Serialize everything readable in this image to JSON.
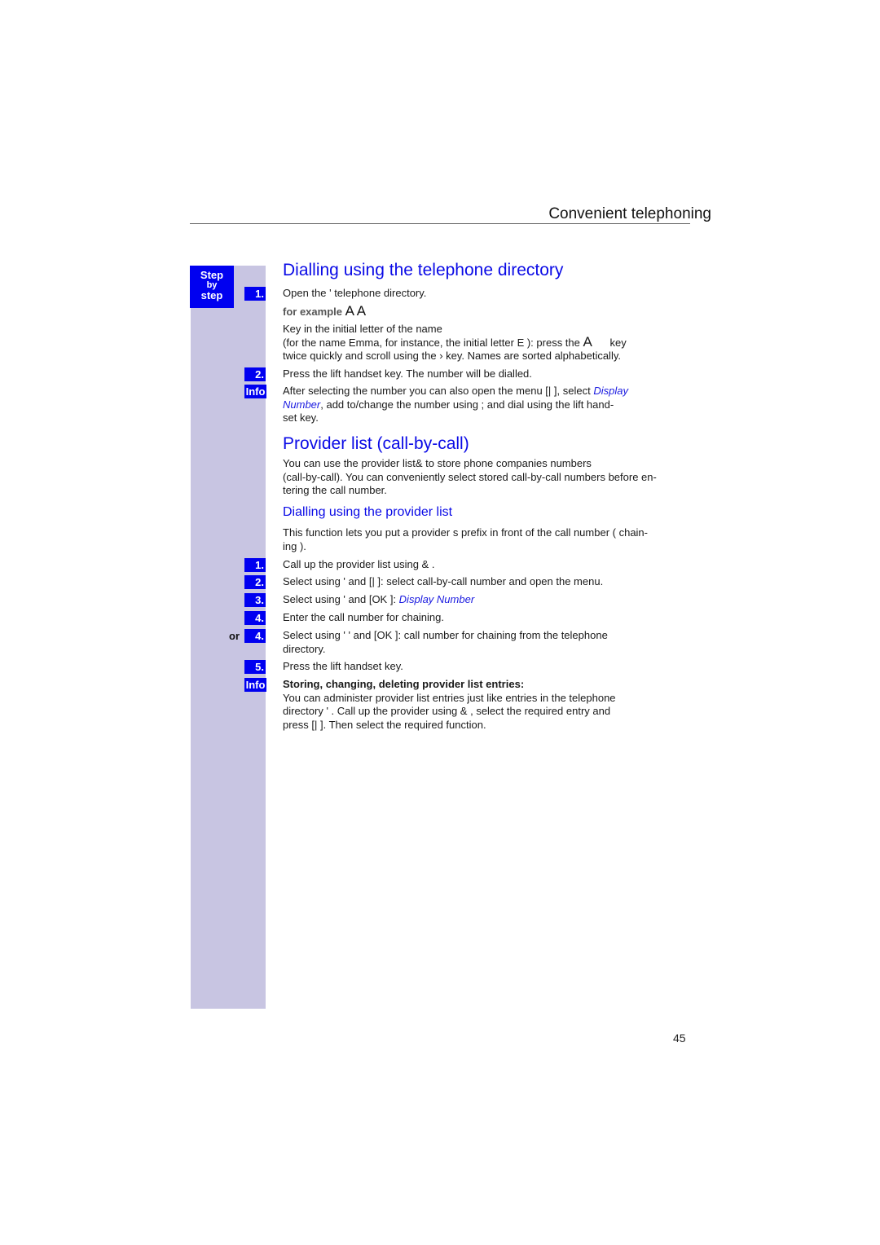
{
  "header": {
    "title": "Convenient telephoning"
  },
  "sidebar": {
    "step_label": [
      "Step",
      "by",
      "step"
    ]
  },
  "section1": {
    "title": "Dialling using the telephone directory",
    "steps": [
      {
        "badge": "1.",
        "text": "Open the '     telephone directory."
      },
      {
        "badge": "2.",
        "text": "Press the        lift handset key. The number will be dialled."
      }
    ],
    "example_label": "for example",
    "example_keys": "A A",
    "key_in_lines": [
      "Key in the initial letter of the name",
      "(for the name   Emma,  for instance, the initial letter   E  ): press the",
      "key",
      "twice quickly and scroll using the ›      key. Names are sorted alphabetically."
    ],
    "key_glyph": "A",
    "info_badge": "Info",
    "info_text_1": "After selecting the number you can also open the menu [|     ], select ",
    "info_link_1": "Display",
    "info_link_2": "Number",
    "info_text_2": ", add to/change the number using ;     and dial using the        lift hand-",
    "info_text_3": "set key."
  },
  "section2": {
    "title": "Provider list (call-by-call)",
    "intro": [
      "You can use the provider list&     to store phone companies  numbers",
      "(call-by-call). You can conveniently select stored call-by-call numbers before en-",
      "tering the call number."
    ],
    "subtitle": "Dialling using the provider list",
    "sub_intro": [
      "This function lets you put a provider s prefix in front of the call number (  chain-",
      "ing  )."
    ],
    "steps": [
      {
        "badge": "1.",
        "text": "Call up the provider list using &    ."
      },
      {
        "badge": "2.",
        "text": "Select using '      and [|     ]: select call-by-call number and open the menu."
      },
      {
        "badge": "3.",
        "text": "Select using '      and [OK ]: ",
        "link": "Display Number"
      },
      {
        "badge": "4.",
        "text": "Enter the call number for   chaining."
      },
      {
        "badge": "4.",
        "prefix": "or",
        "text": "Select using '      '      and [OK ]: call number for   chaining   from the telephone",
        "text2": "directory."
      },
      {
        "badge": "5.",
        "text": "Press the        lift handset key."
      }
    ],
    "info_badge": "Info",
    "info_heading": "Storing, changing, deleting provider list entries:",
    "info_lines": [
      "You can administer provider list entries just like entries in the telephone",
      "directory '     . Call up the provider using &    , select the required entry and",
      "press [|     ]. Then select the required function."
    ]
  },
  "footer": {
    "page_number": "45"
  }
}
